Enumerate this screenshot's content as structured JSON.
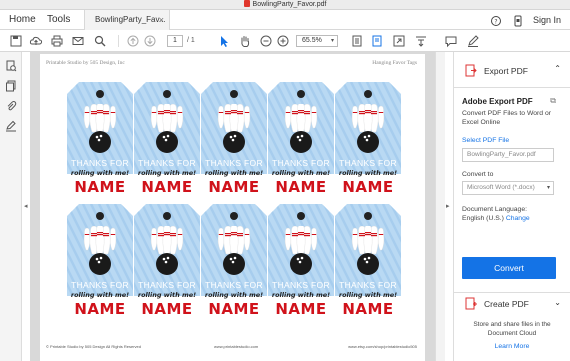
{
  "window": {
    "title": "BowlingParty_Favor.pdf"
  },
  "tabs": {
    "home": "Home",
    "tools": "Tools",
    "document": "BowlingParty_Fav...",
    "close": "×",
    "sign_in": "Sign In"
  },
  "toolbar": {
    "page_current": "1",
    "page_total": "/ 1",
    "zoom": "65.5%"
  },
  "document": {
    "header_left": "Printable Studio by 505 Design, Inc",
    "header_right": "Hanging Favor Tags",
    "footer_left": "© Printable Studio by 505 Design All Rights Reserved",
    "footer_center": "www.printablestudio.com",
    "footer_right": "www.etsy.com/shop/printablestudio505",
    "tag": {
      "thanks": "THANKS FOR",
      "rolling": "rolling with me!",
      "name": "NAME"
    },
    "tag_colors": {
      "light_blue": "#b9d9f3",
      "stripe_blue": "#a7cdee",
      "name_red": "#d0121b"
    }
  },
  "panel": {
    "export_label": "Export PDF",
    "export_title": "Adobe Export PDF",
    "export_desc": "Convert PDF Files to Word or Excel Online",
    "select_file": "Select PDF File",
    "file_name": "BowlingParty_Favor.pdf",
    "convert_to": "Convert to",
    "format": "Microsoft Word (*.docx)",
    "doc_lang_label": "Document Language:",
    "doc_lang_value": "English (U.S.)",
    "change": "Change",
    "convert_button": "Convert",
    "create_label": "Create PDF",
    "store_text": "Store and share files in the Document Cloud",
    "learn_more": "Learn More",
    "accent": "#1473e6"
  }
}
